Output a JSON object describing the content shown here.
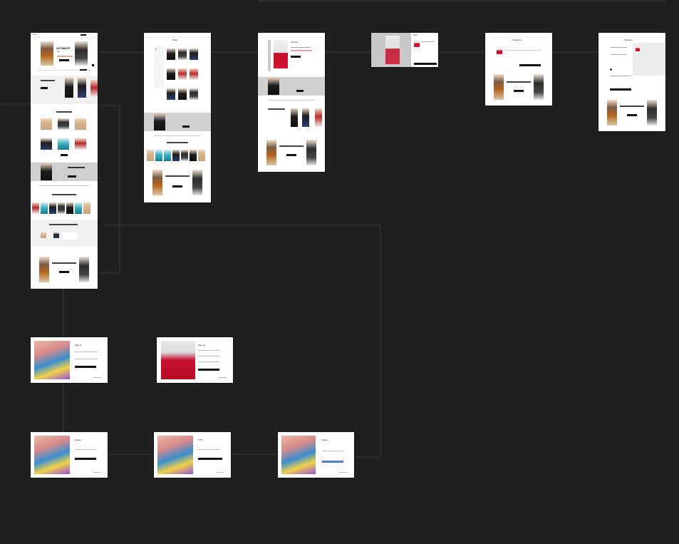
{
  "canvas": {
    "background": "#1f1f1f",
    "connector_color": "#3a3a3a",
    "button_color": "#111111",
    "accent_blue": "#4a7fd6"
  },
  "home": {
    "logo": "LOGO",
    "headline": "ULTIMATE",
    "sub_headline": "Sale",
    "btn": "Shop now"
  },
  "shop": {
    "title": "Shop"
  },
  "product": {
    "title": "Product"
  },
  "cart": {
    "title": "Cart"
  },
  "checkout": {
    "title": "Checkout"
  },
  "payment": {
    "title": "Payment"
  },
  "signin": {
    "title": "Sign in"
  },
  "signup": {
    "title": "Sign up"
  },
  "forgot": {
    "title": "Forgot"
  },
  "otp": {
    "title": "OTP"
  },
  "reset": {
    "title": "Reset"
  }
}
